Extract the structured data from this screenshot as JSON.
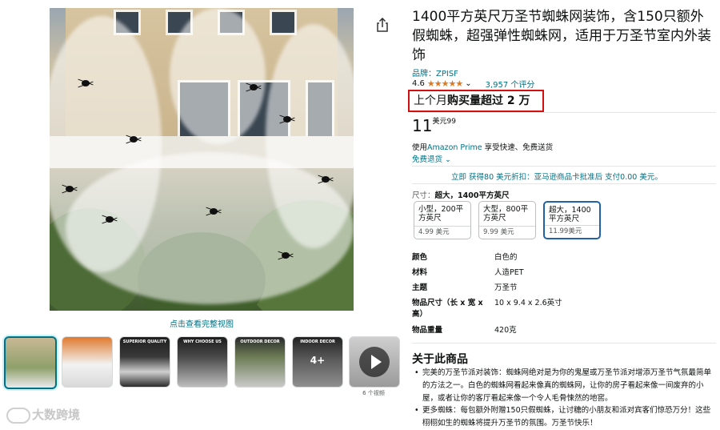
{
  "product": {
    "title": "1400平方英尺万圣节蜘蛛网装饰，含150只额外假蜘蛛，超强弹性蜘蛛网，适用于万圣节室内外装饰",
    "brand": "品牌：ZPISF",
    "rating": "4.6",
    "stars": "★★★★★",
    "rating_count": "3,957 个评分",
    "bought_prefix": "上个月",
    "bought_strong": "购买量超过 2 万"
  },
  "price": {
    "whole": "11",
    "currency": "美元",
    "fraction": "99"
  },
  "delivery": {
    "prefix": "使用",
    "prime": "Amazon Prime",
    "suffix": " 享受快速、免费送货",
    "returns": "免费退货",
    "credit_offer": "立即 获得80 美元折扣：亚马逊商品卡批准后 支付0.00 美元。"
  },
  "size": {
    "label": "尺寸：",
    "selected": "超大，1400平方英尺",
    "options": [
      {
        "name": "小型，200平方英尺",
        "price": "4.99 美元"
      },
      {
        "name": "大型，800平方英尺",
        "price": "9.99 美元"
      },
      {
        "name": "超大，1400平方英尺",
        "price": "11.99美元"
      }
    ]
  },
  "specs": [
    {
      "k": "颜色",
      "v": "白色的"
    },
    {
      "k": "材料",
      "v": "人造PET"
    },
    {
      "k": "主题",
      "v": "万圣节"
    },
    {
      "k": "物品尺寸（长 x 宽 x 高）",
      "v": "10 x 9.4 x 2.6英寸"
    },
    {
      "k": "物品重量",
      "v": "420克"
    }
  ],
  "about": {
    "heading": "关于此商品",
    "bullets": [
      "完美的万圣节派对装饰：蜘蛛网绝对是为你的鬼屋或万圣节派对增添万圣节气氛最简单的方法之一。白色的蜘蛛网看起来像真的蜘蛛网，让你的房子看起来像一间废弃的小屋，或者让你的客厅看起来像一个令人毛骨悚然的地窖。",
      "更多蜘蛛：每包额外附赠150只假蜘蛛，让讨糖的小朋友和派对宾客们惊恐万分！这些栩栩如生的蜘蛛将提升万圣节的氛围。万圣节快乐！"
    ]
  },
  "gallery": {
    "view_full": "点击查看完整视图",
    "more_label": "6 个视频",
    "thumb_labels": [
      "",
      "",
      "SUPERIOR QUALITY",
      "WHY CHOOSE US",
      "OUTDOOR DECOR",
      "INDOOR DECOR",
      ""
    ],
    "more_count": "4+"
  },
  "watermark": "大数跨境",
  "colors": {
    "link": "#007185",
    "star": "#de7921",
    "highlight": "#d70e0e",
    "selected": "#2162a1"
  }
}
